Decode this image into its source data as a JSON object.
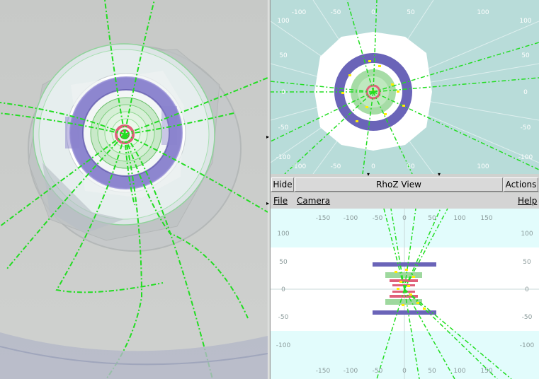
{
  "toolbar": {
    "hide_label": "Hide",
    "view_title": "RhoZ View",
    "actions_label": "Actions"
  },
  "menubar": {
    "file": "File",
    "camera": "Camera",
    "help": "Help"
  },
  "rphi_view": {
    "top_ticks": [
      "-100",
      "-50",
      "0",
      "50",
      "100"
    ],
    "bottom_ticks": [
      "-100",
      "-50",
      "0",
      "50",
      "100"
    ],
    "left_ticks": [
      "100",
      "50",
      "0",
      "-50",
      "-100"
    ],
    "right_ticks": [
      "100",
      "50",
      "0",
      "-50",
      "-100"
    ]
  },
  "rhoz_view": {
    "top_ticks": [
      "-150",
      "-100",
      "-50",
      "0",
      "50",
      "100",
      "150"
    ],
    "bottom_ticks": [
      "-150",
      "-100",
      "-50",
      "0",
      "50",
      "100",
      "150"
    ],
    "left_ticks": [
      "100",
      "50",
      "0",
      "-50",
      "-100"
    ],
    "right_ticks": [
      "100",
      "50",
      "0",
      "-50",
      "-100"
    ]
  },
  "colors": {
    "track": "#22dd22",
    "hit": "#ffee00",
    "calo": "#7a72c8",
    "tracker": "#9ed89e",
    "pixel": "#e0607a",
    "detector_bg": "#b8dcd9",
    "rhoz_bg": "#e2fcfc"
  }
}
